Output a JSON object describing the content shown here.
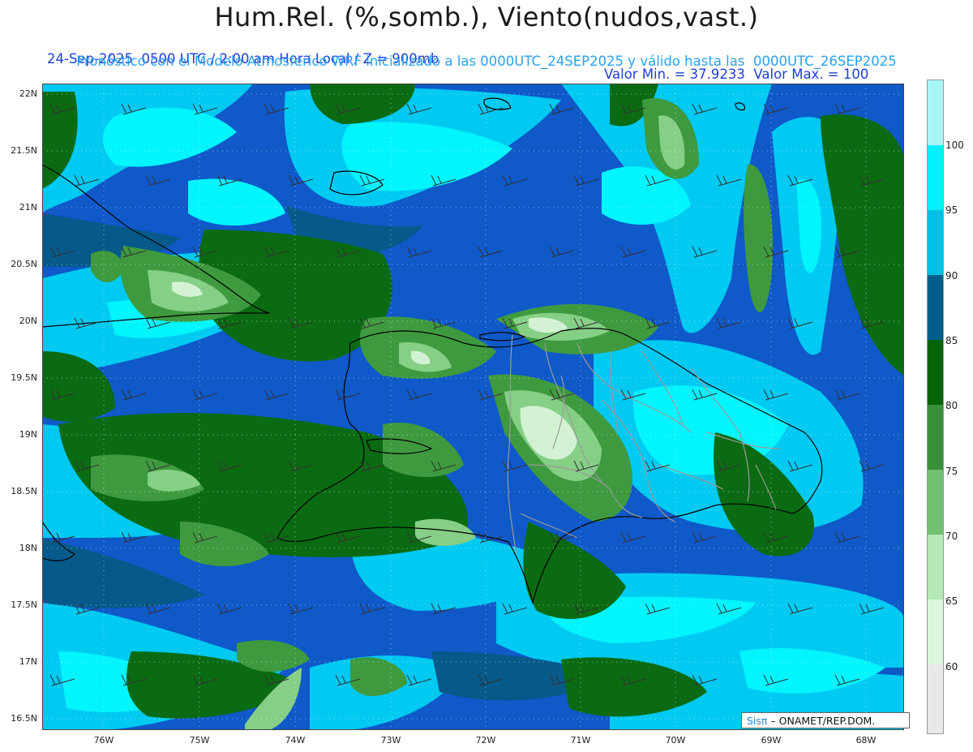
{
  "header": {
    "title": "Hum.Rel. (%,somb.), Viento(nudos,vast.)",
    "date_line": "24-Sep-2025  0500 UTC / 2:00 am Hora Local / Z = 900mb",
    "minmax_line": "Valor Min. = 37.9233  Valor Max. = 100",
    "model_line": "Pronóstico con el Modelo Atmosferico WRF inicializado a las 0000UTC_24SEP2025 y válido hasta las  0000UTC_26SEP2025"
  },
  "axes": {
    "lat_labels": [
      "22N",
      "21.5N",
      "21N",
      "20.5N",
      "20N",
      "19.5N",
      "19N",
      "18.5N",
      "18N",
      "17.5N",
      "17N",
      "16.5N"
    ],
    "lon_labels": [
      "76W",
      "75W",
      "74W",
      "73W",
      "72W",
      "71W",
      "70W",
      "69W",
      "68W"
    ]
  },
  "colorbar": {
    "labels": [
      "100",
      "95",
      "90",
      "85",
      "80",
      "75",
      "70",
      "65",
      "60"
    ],
    "colors": [
      "#a8f4f8",
      "#00f0ff",
      "#00c0e8",
      "#005e8c",
      "#056405",
      "#3a8f3a",
      "#72be72",
      "#b4e8b4",
      "#dcf7dc",
      "#e8e8e8"
    ]
  },
  "palette": {
    "background": "#1a3fc4",
    "deep_blue": "#0f59c9",
    "cyan": "#00c9f2",
    "bright_cyan": "#00f5ff",
    "navy": "#055a8a",
    "dark_green": "#0b6b12",
    "mid_green": "#3f9a3f",
    "light_green": "#86cf86",
    "pale_green": "#d3f2d3",
    "coast": "#000000",
    "borders": "#9a9a9a"
  },
  "credit": {
    "sis": "Sisπ",
    "org": "– ONAMET/REP.DOM."
  }
}
